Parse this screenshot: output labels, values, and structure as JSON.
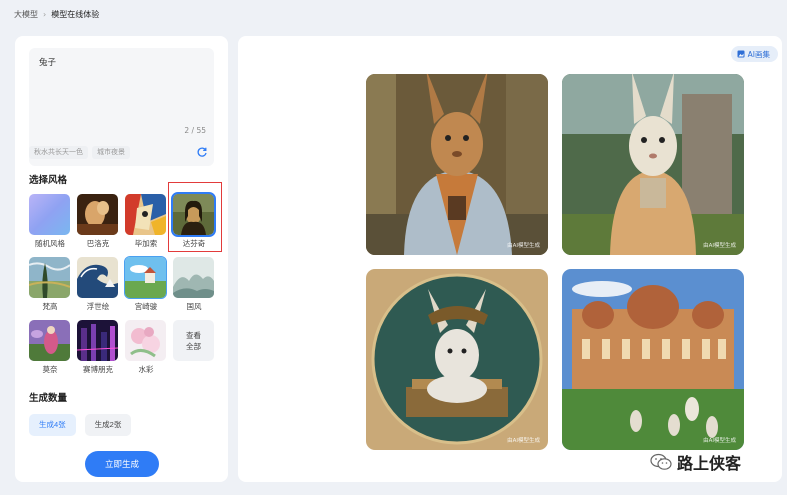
{
  "breadcrumb": {
    "parent": "大模型",
    "current": "模型在线体验"
  },
  "prompt": {
    "value": "兔子",
    "counter": "2 / 55",
    "tags": [
      "秋水共长天一色",
      "城市夜景"
    ]
  },
  "style_section": {
    "title": "选择风格",
    "items": [
      {
        "label": "随机风格"
      },
      {
        "label": "巴洛克"
      },
      {
        "label": "毕加索"
      },
      {
        "label": "达芬奇"
      },
      {
        "label": "梵高"
      },
      {
        "label": "浮世绘"
      },
      {
        "label": "宫崎骏"
      },
      {
        "label": "国风"
      },
      {
        "label": "莫奈"
      },
      {
        "label": "赛博朋克"
      },
      {
        "label": "水彩"
      }
    ],
    "view_all": "查看全部",
    "view_all_line1": "查看",
    "view_all_line2": "全部",
    "selected": "达芬奇"
  },
  "count_section": {
    "title": "生成数量",
    "options": [
      "生成4张",
      "生成2张"
    ],
    "selected": "生成4张"
  },
  "generate_label": "立即生成",
  "gallery": {
    "button_label": "AI画集",
    "watermark": "由AI模型生成"
  },
  "brand": {
    "name": "路上侠客"
  },
  "colors": {
    "accent": "#2f7cf6",
    "highlight": "#e23b3b"
  }
}
